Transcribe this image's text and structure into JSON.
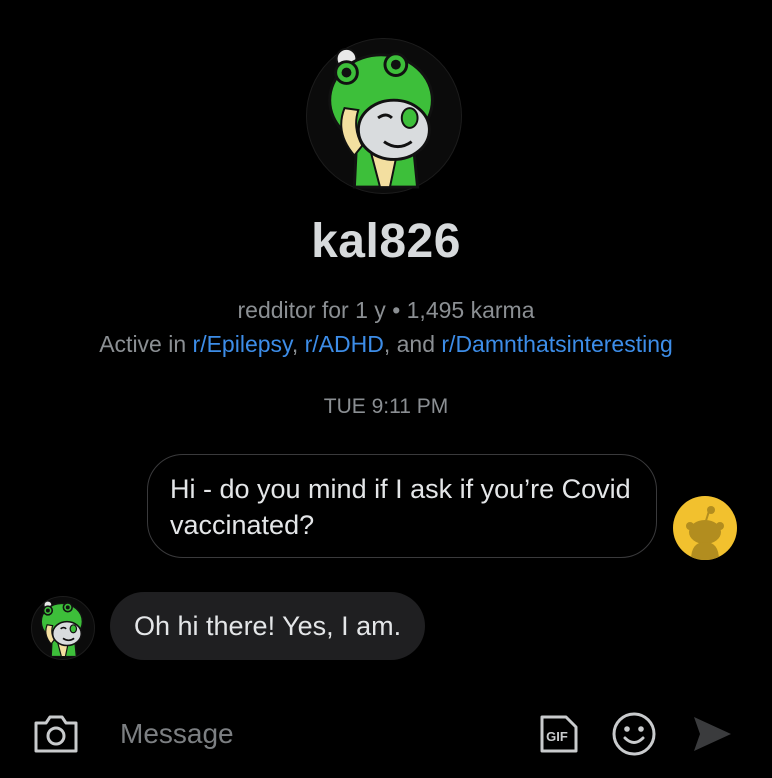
{
  "profile": {
    "username": "kal826",
    "tenure": "redditor for 1 y",
    "separator": "•",
    "karma": "1,495 karma",
    "active_prefix": "Active in",
    "communities": [
      "r/Epilepsy",
      "r/ADHD",
      "r/Damnthatsinteresting"
    ],
    "comma": ",",
    "and_word": ", and",
    "avatar_icon": "snoo-frog-hood-avatar-icon"
  },
  "conversation": {
    "timestamp": "TUE 9:11 PM",
    "messages": [
      {
        "sender": "me",
        "text": "Hi - do you mind if I ask if you’re Covid vaccinated?",
        "avatar_icon": "snoo-default-yellow-avatar-icon"
      },
      {
        "sender": "kal826",
        "text": "Oh hi there! Yes, I am.",
        "avatar_icon": "snoo-frog-hood-avatar-icon"
      }
    ]
  },
  "composer": {
    "placeholder": "Message",
    "camera_icon": "camera-icon",
    "gif_label": "GIF",
    "emoji_icon": "emoji-icon",
    "send_icon": "send-icon"
  },
  "colors": {
    "background": "#000000",
    "link": "#3d8de8",
    "muted_text": "#8b8f93",
    "bubble_incoming": "#1f1f21",
    "bubble_outgoing_border": "#3a3a3c",
    "my_avatar_bg": "#f2c12e",
    "avatar_green": "#3dbf3a"
  }
}
